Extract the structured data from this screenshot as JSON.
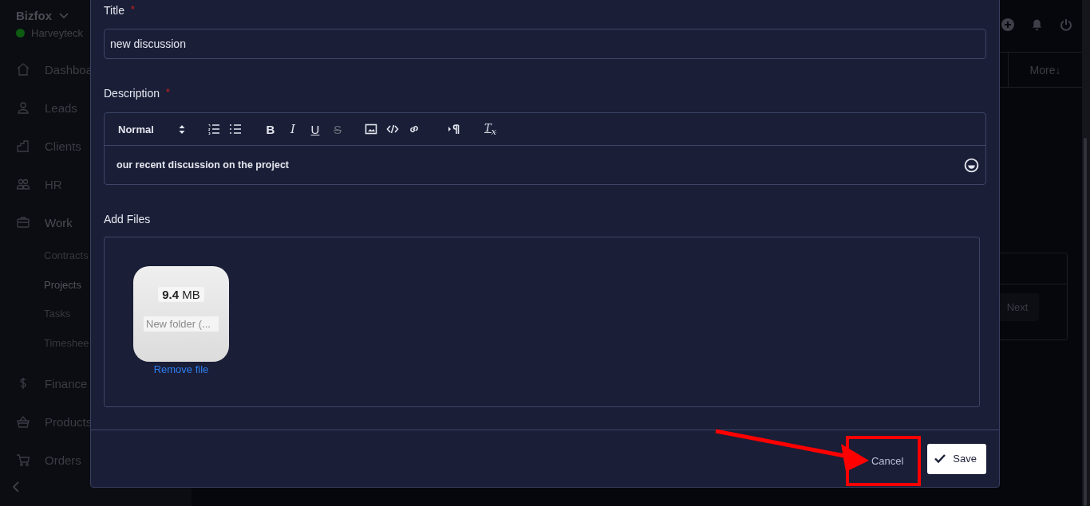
{
  "sidebar": {
    "brand": "Bizfox",
    "org": {
      "name": "Harveyteck",
      "online": true
    },
    "items": [
      {
        "label": "Dashboa",
        "kind": "home"
      },
      {
        "label": "Leads",
        "kind": "person"
      },
      {
        "label": "Clients",
        "kind": "building"
      },
      {
        "label": "HR",
        "kind": "people"
      },
      {
        "label": "Work",
        "kind": "briefcase",
        "children": [
          {
            "label": "Contracts",
            "selected": false
          },
          {
            "label": "Projects",
            "selected": true
          },
          {
            "label": "Tasks",
            "selected": false
          },
          {
            "label": "Timeshee",
            "selected": false
          }
        ]
      },
      {
        "label": "Finance",
        "kind": "dollar"
      },
      {
        "label": "Products",
        "kind": "basket"
      },
      {
        "label": "Orders",
        "kind": "cart"
      }
    ]
  },
  "tabs_bar": {
    "more": "More↓"
  },
  "pagination": {
    "next": "Next"
  },
  "modal": {
    "title_field": {
      "label": "Title",
      "required_marker": "*",
      "value": "new discussion"
    },
    "description": {
      "label": "Description",
      "required_marker": "*",
      "toolbar": [
        {
          "kind": "select",
          "text": "Normal"
        },
        {
          "kind": "ordered-list"
        },
        {
          "kind": "bullet-list"
        },
        {
          "kind": "bold",
          "text": "B"
        },
        {
          "kind": "italic",
          "text": "I"
        },
        {
          "kind": "underline",
          "text": "U"
        },
        {
          "kind": "strike",
          "text": "S"
        },
        {
          "kind": "image"
        },
        {
          "kind": "code"
        },
        {
          "kind": "link"
        },
        {
          "kind": "direction"
        },
        {
          "kind": "clean",
          "text": "T$_{x}$"
        }
      ],
      "content": "our recent discussion on the project"
    },
    "files": {
      "label": "Add Files",
      "items": [
        {
          "size": "**9.4** MB",
          "name": "New folder (...",
          "remove": "Remove file"
        }
      ]
    },
    "buttons": [
      {
        "label": "Cancel",
        "kind": "link"
      },
      {
        "label": "Save",
        "kind": "primary"
      }
    ]
  },
  "annotations": {
    "arrow": true,
    "highlight_frame": true
  }
}
